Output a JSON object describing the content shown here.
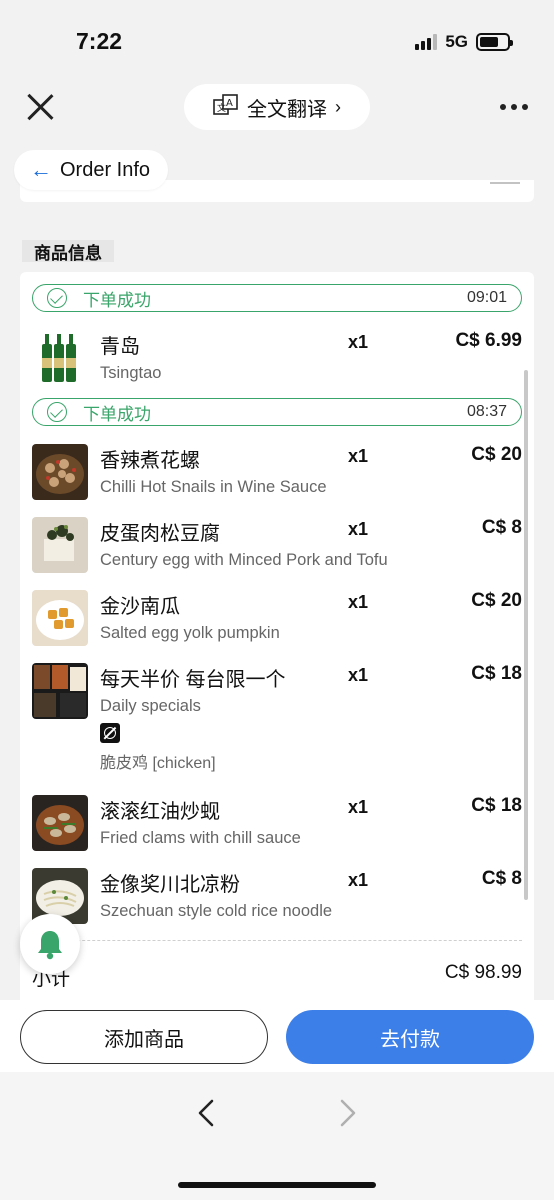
{
  "status": {
    "time": "7:22",
    "network": "5G",
    "battery_level": 0.7
  },
  "nav": {
    "translate_label": "全文翻译",
    "translate_chevron": "›"
  },
  "header": {
    "back_arrow": "←",
    "title": "Order Info"
  },
  "section": {
    "title": "商品信息"
  },
  "batches": [
    {
      "status": "下单成功",
      "time": "09:01"
    },
    {
      "status": "下单成功",
      "time": "08:37"
    }
  ],
  "items": [
    {
      "name_zh": "青岛",
      "name_en": "Tsingtao",
      "qty": "x1",
      "price": "C$ 6.99",
      "icon": "beer-bottles-image"
    },
    {
      "name_zh": "香辣煮花螺",
      "name_en": "Chilli Hot Snails in Wine Sauce",
      "qty": "x1",
      "price": "C$ 20",
      "icon": "snails-dish-image"
    },
    {
      "name_zh": "皮蛋肉松豆腐",
      "name_en": "Century egg with Minced Pork and Tofu",
      "qty": "x1",
      "price": "C$ 8",
      "icon": "tofu-dish-image"
    },
    {
      "name_zh": "金沙南瓜",
      "name_en": "Salted egg yolk pumpkin",
      "qty": "x1",
      "price": "C$ 20",
      "icon": "pumpkin-dish-image"
    },
    {
      "name_zh": "每天半价 每台限一个",
      "name_en": "Daily specials",
      "qty": "x1",
      "price": "C$ 18",
      "modifier": "脆皮鸡 [chicken]",
      "icon": "daily-special-image"
    },
    {
      "name_zh": "滚滚红油炒蚬",
      "name_en": "Fried clams with chill sauce",
      "qty": "x1",
      "price": "C$ 18",
      "icon": "clams-dish-image"
    },
    {
      "name_zh": "金像奖川北凉粉",
      "name_en": "Szechuan style cold rice noodle",
      "qty": "x1",
      "price": "C$ 8",
      "icon": "noodle-dish-image"
    }
  ],
  "subtotal": {
    "label": "小计",
    "value": "C$ 98.99"
  },
  "actions": {
    "add_label": "添加商品",
    "pay_label": "去付款"
  },
  "colors": {
    "accent_blue": "#3d7fe8",
    "success_green": "#3aa56a",
    "link_blue": "#1b6cd9"
  }
}
